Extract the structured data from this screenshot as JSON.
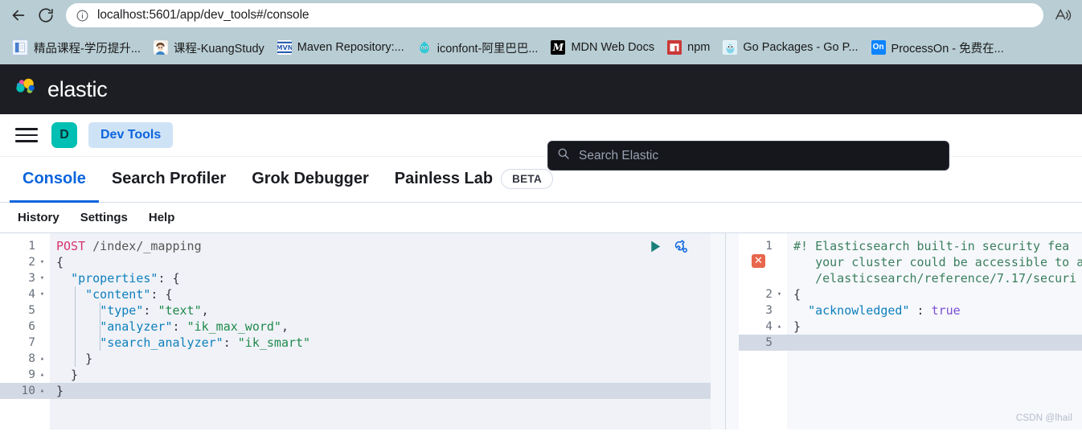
{
  "browser": {
    "back_label": "Back",
    "reload_label": "Refresh",
    "site_info_label": "View site information",
    "url": "localhost:5601/app/dev_tools#/console",
    "url_host": "localhost",
    "url_path": ":5601/app/dev_tools#/console",
    "read_aloud_label": "Read aloud",
    "bookmarks": [
      {
        "label": "精品课程-学历提升...",
        "icon": "document-icon",
        "color": "#4a7fd0"
      },
      {
        "label": "课程-KuangStudy",
        "icon": "avatar-icon",
        "color": "#7e5a3d"
      },
      {
        "label": "Maven Repository:...",
        "icon": "mvn-icon",
        "color": "#2a5db0"
      },
      {
        "label": "iconfont-阿里巴巴...",
        "icon": "iconfont-icon",
        "color": "#36c8d4"
      },
      {
        "label": "MDN Web Docs",
        "icon": "mdn-icon",
        "color": "#000000"
      },
      {
        "label": "npm",
        "icon": "npm-icon",
        "color": "#cb3837"
      },
      {
        "label": "Go Packages - Go P...",
        "icon": "go-gopher-icon",
        "color": "#7fd5ea"
      },
      {
        "label": "ProcessOn - 免费在...",
        "icon": "processon-icon",
        "color": "#0c84ff"
      }
    ]
  },
  "app": {
    "brand": "elastic",
    "search_placeholder": "Search Elastic",
    "space_initial": "D",
    "breadcrumb": "Dev Tools",
    "menu_label": "Toggle primary navigation"
  },
  "tabs": [
    {
      "label": "Console",
      "active": true,
      "badge": null
    },
    {
      "label": "Search Profiler",
      "active": false,
      "badge": null
    },
    {
      "label": "Grok Debugger",
      "active": false,
      "badge": null
    },
    {
      "label": "Painless Lab",
      "active": false,
      "badge": "BETA"
    }
  ],
  "subnav": [
    {
      "label": "History"
    },
    {
      "label": "Settings"
    },
    {
      "label": "Help"
    }
  ],
  "console": {
    "play_label": "Click to send request",
    "wrench_label": "Open documentation",
    "request_lines": [
      {
        "n": 1,
        "fold": "",
        "tokens": [
          {
            "t": "POST",
            "c": "tok-method"
          },
          {
            "t": " /index/_mapping",
            "c": "tok-path"
          }
        ]
      },
      {
        "n": 2,
        "fold": "down",
        "tokens": [
          {
            "t": "{",
            "c": "tok-punc"
          }
        ]
      },
      {
        "n": 3,
        "fold": "down",
        "tokens": [
          {
            "t": "  ",
            "c": "tok-punc"
          },
          {
            "t": "\"properties\"",
            "c": "tok-key"
          },
          {
            "t": ": {",
            "c": "tok-punc"
          }
        ]
      },
      {
        "n": 4,
        "fold": "down",
        "tokens": [
          {
            "t": "    ",
            "c": "tok-punc"
          },
          {
            "t": "\"content\"",
            "c": "tok-key"
          },
          {
            "t": ": {",
            "c": "tok-punc"
          }
        ]
      },
      {
        "n": 5,
        "fold": "",
        "tokens": [
          {
            "t": "      ",
            "c": "tok-punc"
          },
          {
            "t": "\"type\"",
            "c": "tok-key"
          },
          {
            "t": ": ",
            "c": "tok-punc"
          },
          {
            "t": "\"text\"",
            "c": "tok-str"
          },
          {
            "t": ",",
            "c": "tok-punc"
          }
        ]
      },
      {
        "n": 6,
        "fold": "",
        "tokens": [
          {
            "t": "      ",
            "c": "tok-punc"
          },
          {
            "t": "\"analyzer\"",
            "c": "tok-key"
          },
          {
            "t": ": ",
            "c": "tok-punc"
          },
          {
            "t": "\"ik_max_word\"",
            "c": "tok-str"
          },
          {
            "t": ",",
            "c": "tok-punc"
          }
        ]
      },
      {
        "n": 7,
        "fold": "",
        "tokens": [
          {
            "t": "      ",
            "c": "tok-punc"
          },
          {
            "t": "\"search_analyzer\"",
            "c": "tok-key"
          },
          {
            "t": ": ",
            "c": "tok-punc"
          },
          {
            "t": "\"ik_smart\"",
            "c": "tok-str"
          }
        ]
      },
      {
        "n": 8,
        "fold": "up",
        "tokens": [
          {
            "t": "    }",
            "c": "tok-punc"
          }
        ]
      },
      {
        "n": 9,
        "fold": "up",
        "tokens": [
          {
            "t": "  }",
            "c": "tok-punc"
          }
        ]
      },
      {
        "n": 10,
        "fold": "up",
        "active": true,
        "tokens": [
          {
            "t": "}",
            "c": "tok-punc"
          }
        ]
      }
    ],
    "response_lines": [
      {
        "n": 1,
        "fold": "",
        "tokens": [
          {
            "t": "#! Elasticsearch built-in security fea",
            "c": "tok-comment"
          }
        ]
      },
      {
        "n": "",
        "fold": "",
        "tokens": [
          {
            "t": "   your cluster could be accessible to a",
            "c": "tok-comment"
          }
        ]
      },
      {
        "n": "",
        "fold": "",
        "tokens": [
          {
            "t": "   /elasticsearch/reference/7.17/securi",
            "c": "tok-comment"
          }
        ]
      },
      {
        "n": 2,
        "fold": "down",
        "tokens": [
          {
            "t": "{",
            "c": "tok-punc"
          }
        ]
      },
      {
        "n": 3,
        "fold": "",
        "tokens": [
          {
            "t": "  ",
            "c": "tok-punc"
          },
          {
            "t": "\"acknowledged\"",
            "c": "tok-key"
          },
          {
            "t": " : ",
            "c": "tok-punc"
          },
          {
            "t": "true",
            "c": "tok-bool"
          }
        ]
      },
      {
        "n": 4,
        "fold": "up",
        "tokens": [
          {
            "t": "}",
            "c": "tok-punc"
          }
        ]
      },
      {
        "n": 5,
        "fold": "",
        "active": true,
        "tokens": [
          {
            "t": "",
            "c": "tok-punc"
          }
        ]
      }
    ],
    "error_marker_label": "error"
  },
  "watermark": "CSDN @lhail",
  "colors": {
    "accent": "#0b64dd",
    "elastic_dark": "#1d1e24",
    "teal": "#00bfb3",
    "error_red": "#e7664c",
    "browser_chrome": "#b8cdd4"
  }
}
